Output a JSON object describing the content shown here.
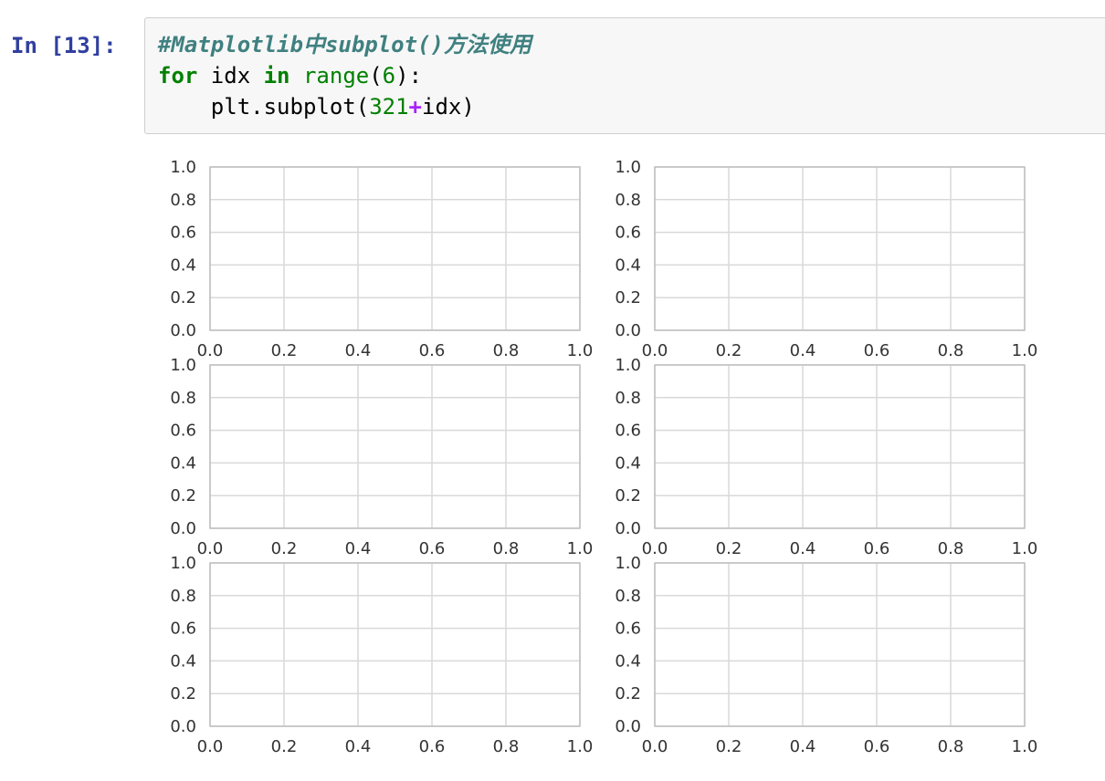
{
  "cell": {
    "prompt": "In [13]:",
    "code": {
      "comment": "#Matplotlib中subplot()方法使用",
      "line2_kw_for": "for",
      "line2_var": " idx ",
      "line2_kw_in": "in",
      "line2_sp": " ",
      "line2_func": "range",
      "line2_open": "(",
      "line2_num": "6",
      "line2_close": "):",
      "line3_indent": "    ",
      "line3_call": "plt.subplot(",
      "line3_num": "321",
      "line3_op": "+",
      "line3_rest": "idx)"
    }
  },
  "chart_data": [
    {
      "type": "scatter",
      "subplot": 321,
      "series": [],
      "xlim": [
        0.0,
        1.0
      ],
      "ylim": [
        0.0,
        1.0
      ],
      "xticks": [
        "0.0",
        "0.2",
        "0.4",
        "0.6",
        "0.8",
        "1.0"
      ],
      "yticks": [
        "0.0",
        "0.2",
        "0.4",
        "0.6",
        "0.8",
        "1.0"
      ],
      "grid": true
    },
    {
      "type": "scatter",
      "subplot": 322,
      "series": [],
      "xlim": [
        0.0,
        1.0
      ],
      "ylim": [
        0.0,
        1.0
      ],
      "xticks": [
        "0.0",
        "0.2",
        "0.4",
        "0.6",
        "0.8",
        "1.0"
      ],
      "yticks": [
        "0.0",
        "0.2",
        "0.4",
        "0.6",
        "0.8",
        "1.0"
      ],
      "grid": true
    },
    {
      "type": "scatter",
      "subplot": 323,
      "series": [],
      "xlim": [
        0.0,
        1.0
      ],
      "ylim": [
        0.0,
        1.0
      ],
      "xticks": [
        "0.0",
        "0.2",
        "0.4",
        "0.6",
        "0.8",
        "1.0"
      ],
      "yticks": [
        "0.0",
        "0.2",
        "0.4",
        "0.6",
        "0.8",
        "1.0"
      ],
      "grid": true
    },
    {
      "type": "scatter",
      "subplot": 324,
      "series": [],
      "xlim": [
        0.0,
        1.0
      ],
      "ylim": [
        0.0,
        1.0
      ],
      "xticks": [
        "0.0",
        "0.2",
        "0.4",
        "0.6",
        "0.8",
        "1.0"
      ],
      "yticks": [
        "0.0",
        "0.2",
        "0.4",
        "0.6",
        "0.8",
        "1.0"
      ],
      "grid": true
    },
    {
      "type": "scatter",
      "subplot": 325,
      "series": [],
      "xlim": [
        0.0,
        1.0
      ],
      "ylim": [
        0.0,
        1.0
      ],
      "xticks": [
        "0.0",
        "0.2",
        "0.4",
        "0.6",
        "0.8",
        "1.0"
      ],
      "yticks": [
        "0.0",
        "0.2",
        "0.4",
        "0.6",
        "0.8",
        "1.0"
      ],
      "grid": true
    },
    {
      "type": "scatter",
      "subplot": 326,
      "series": [],
      "xlim": [
        0.0,
        1.0
      ],
      "ylim": [
        0.0,
        1.0
      ],
      "xticks": [
        "0.0",
        "0.2",
        "0.4",
        "0.6",
        "0.8",
        "1.0"
      ],
      "yticks": [
        "0.0",
        "0.2",
        "0.4",
        "0.6",
        "0.8",
        "1.0"
      ],
      "grid": true
    }
  ],
  "colors": {
    "prompt": "#303F9F",
    "axes_frame": "#bfbfbf",
    "grid": "#d9d9d9",
    "tick_text": "#333333"
  }
}
